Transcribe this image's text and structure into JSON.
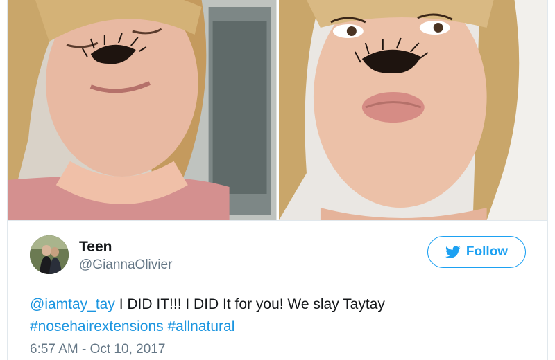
{
  "media": {
    "photo_count": 2,
    "photos": [
      {
        "alt": ""
      },
      {
        "alt": ""
      }
    ]
  },
  "user": {
    "name": "Teen",
    "handle": "@GiannaOlivier"
  },
  "follow_button": {
    "label": "Follow",
    "icon": "bird-icon"
  },
  "tweet": {
    "mention": "@iamtay_tay",
    "text": " I DID IT!!! I DID It for you! We slay Taytay",
    "hashtags": [
      "#nosehairextensions",
      "#allnatural"
    ]
  },
  "timestamp": "6:57 AM - Oct 10, 2017",
  "colors": {
    "link": "#1b95e0",
    "brand": "#1da1f2",
    "secondary_text": "#657786",
    "border": "#e1e8ed"
  }
}
